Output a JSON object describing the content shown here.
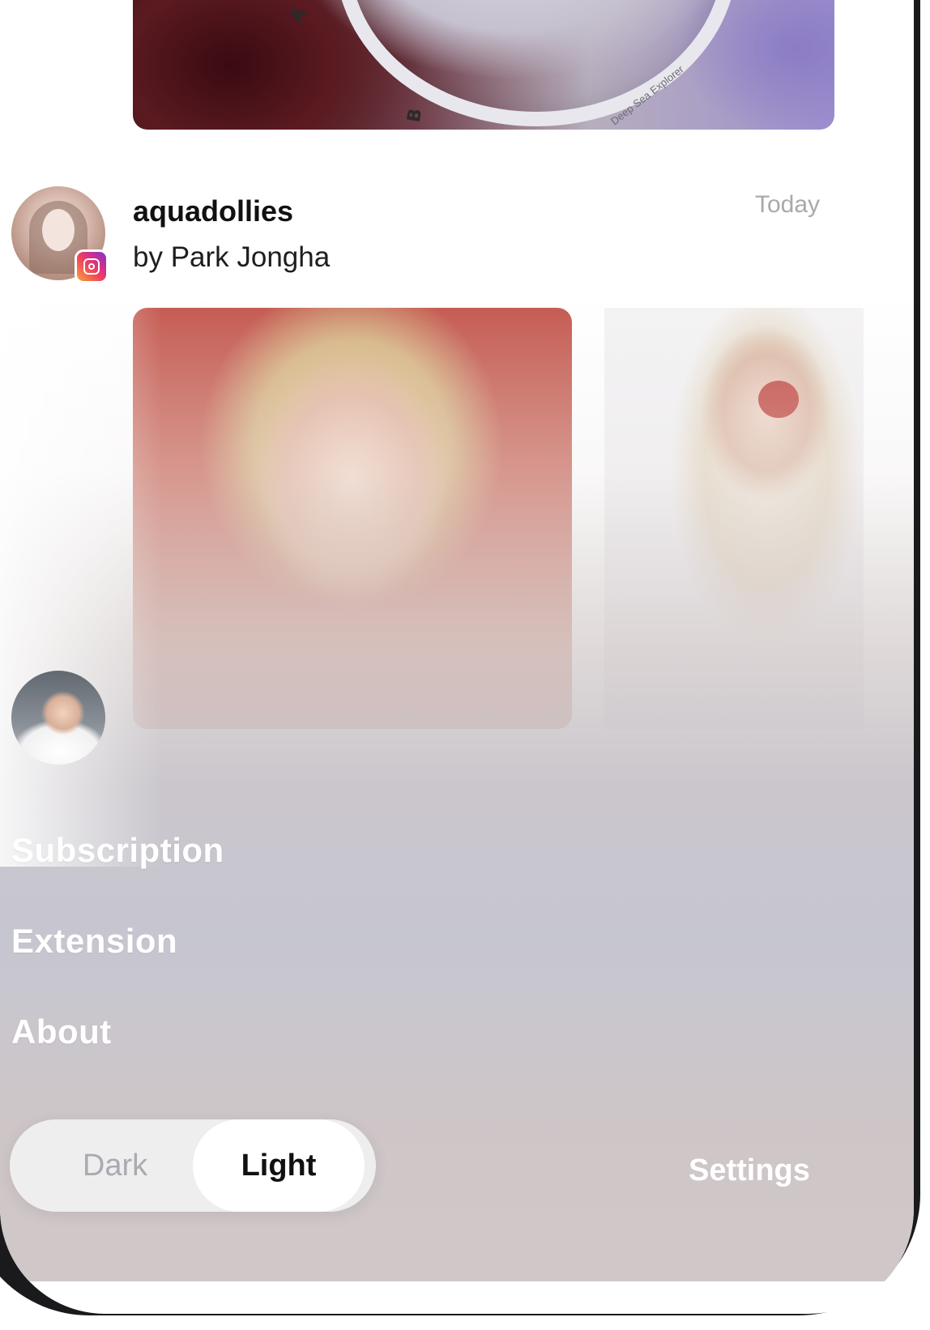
{
  "feed": {
    "top_post_image": {
      "dial_letters": [
        "A",
        "B"
      ],
      "dial_text": "Deep Sea Explorer"
    },
    "post": {
      "username": "aquadollies",
      "byline": "by Park Jongha",
      "timestamp": "Today",
      "source_icon": "instagram-icon"
    }
  },
  "drawer": {
    "menu": [
      {
        "label": "Subscription"
      },
      {
        "label": "Extension"
      },
      {
        "label": "About"
      }
    ],
    "theme_toggle": {
      "options": [
        "Dark",
        "Light"
      ],
      "selected": "Light"
    },
    "settings_label": "Settings"
  },
  "colors": {
    "accent_text": "#111111",
    "muted_text": "#a9a9a9",
    "drawer_text": "#ffffff"
  }
}
